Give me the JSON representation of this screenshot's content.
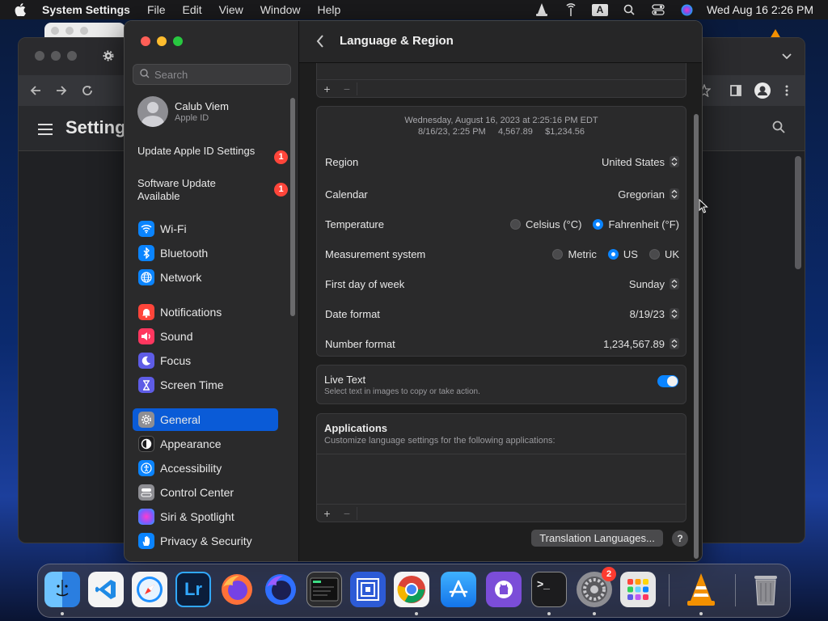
{
  "menubar": {
    "app_name": "System Settings",
    "menus": [
      "File",
      "Edit",
      "View",
      "Window",
      "Help"
    ],
    "clock": "Wed Aug 16  2:26 PM",
    "input_source": "A"
  },
  "background_window": {
    "title": "Settings"
  },
  "sidebar": {
    "search_placeholder": "Search",
    "profile": {
      "name": "Calub Viem",
      "subtitle": "Apple ID"
    },
    "notices": [
      {
        "label": "Update Apple ID Settings",
        "badge": "1"
      },
      {
        "label": "Software Update Available",
        "badge": "1"
      }
    ],
    "items": [
      {
        "label": "Wi-Fi",
        "icon": "wifi-icon",
        "color": "#0a84ff"
      },
      {
        "label": "Bluetooth",
        "icon": "bluetooth-icon",
        "color": "#0a84ff"
      },
      {
        "label": "Network",
        "icon": "globe-icon",
        "color": "#0a84ff"
      },
      {
        "label": "Notifications",
        "icon": "bell-icon",
        "color": "#ff453a"
      },
      {
        "label": "Sound",
        "icon": "speaker-icon",
        "color": "#ff375f"
      },
      {
        "label": "Focus",
        "icon": "moon-icon",
        "color": "#5e5ce6"
      },
      {
        "label": "Screen Time",
        "icon": "hourglass-icon",
        "color": "#5e5ce6"
      },
      {
        "label": "General",
        "icon": "gear-icon",
        "color": "#8e8e93",
        "active": true
      },
      {
        "label": "Appearance",
        "icon": "appearance-icon",
        "color": "#1c1c1e"
      },
      {
        "label": "Accessibility",
        "icon": "accessibility-icon",
        "color": "#0a84ff"
      },
      {
        "label": "Control Center",
        "icon": "control-center-icon",
        "color": "#8e8e93"
      },
      {
        "label": "Siri & Spotlight",
        "icon": "siri-icon",
        "color": "#bf5af2"
      },
      {
        "label": "Privacy & Security",
        "icon": "hand-icon",
        "color": "#0a84ff"
      }
    ]
  },
  "main": {
    "title": "Language & Region",
    "sample": {
      "line1": "Wednesday, August 16, 2023 at 2:25:16 PM EDT",
      "line2": "8/16/23, 2:25 PM     4,567.89     $1,234.56"
    },
    "rows": {
      "region": {
        "label": "Region",
        "value": "United States"
      },
      "calendar": {
        "label": "Calendar",
        "value": "Gregorian"
      },
      "temperature": {
        "label": "Temperature",
        "options": [
          "Celsius (°C)",
          "Fahrenheit (°F)"
        ],
        "selected": "Fahrenheit (°F)"
      },
      "measurement": {
        "label": "Measurement system",
        "options": [
          "Metric",
          "US",
          "UK"
        ],
        "selected": "US"
      },
      "first_day": {
        "label": "First day of week",
        "value": "Sunday"
      },
      "date_format": {
        "label": "Date format",
        "value": "8/19/23"
      },
      "number_format": {
        "label": "Number format",
        "value": "1,234,567.89"
      }
    },
    "live_text": {
      "title": "Live Text",
      "subtitle": "Select text in images to copy or take action.",
      "enabled": true
    },
    "applications": {
      "title": "Applications",
      "subtitle": "Customize language settings for the following applications:"
    },
    "add_symbol": "+",
    "remove_symbol": "−",
    "translation_button": "Translation Languages...",
    "help_symbol": "?"
  },
  "dock": {
    "apps": [
      {
        "name": "Finder",
        "icon": "finder-icon",
        "color": "#3a8ee6",
        "running": true
      },
      {
        "name": "Visual Studio Code",
        "icon": "vscode-icon",
        "color": "#f4f4f4",
        "running": false
      },
      {
        "name": "Safari",
        "icon": "safari-icon",
        "color": "#f4f4f4",
        "running": false
      },
      {
        "name": "Lightroom",
        "icon": "lightroom-icon",
        "color": "#0b1d3a",
        "label": "Lr",
        "running": false
      },
      {
        "name": "Firefox",
        "icon": "firefox-icon",
        "color": "#ff7139",
        "running": false
      },
      {
        "name": "Firefox Nightly",
        "icon": "firefox-nightly-icon",
        "color": "#5b4fe0",
        "running": false
      },
      {
        "name": "Console",
        "icon": "console-icon",
        "color": "#2c2c2e",
        "running": false
      },
      {
        "name": "Instruments",
        "icon": "instruments-icon",
        "color": "#2d5bd6",
        "running": false
      },
      {
        "name": "Chrome",
        "icon": "chrome-icon",
        "color": "#f4f4f4",
        "running": true
      },
      {
        "name": "App Store",
        "icon": "app-store-icon",
        "color": "#1e8cfa",
        "running": false
      },
      {
        "name": "GitHub Desktop",
        "icon": "github-icon",
        "color": "#7b4dd8",
        "running": false
      },
      {
        "name": "Terminal",
        "icon": "terminal-icon",
        "color": "#1c1c1e",
        "label": ">_",
        "running": true
      },
      {
        "name": "System Settings",
        "icon": "system-settings-icon",
        "color": "#8e8e93",
        "badge": "2",
        "running": true
      },
      {
        "name": "Launchpad",
        "icon": "launchpad-icon",
        "color": "#e6e6e6",
        "running": false
      },
      {
        "name": "VLC",
        "icon": "vlc-icon",
        "color": "#f39000",
        "running": true
      },
      {
        "name": "Trash",
        "icon": "trash-icon",
        "color": "#9a9aa0",
        "running": false
      }
    ]
  }
}
